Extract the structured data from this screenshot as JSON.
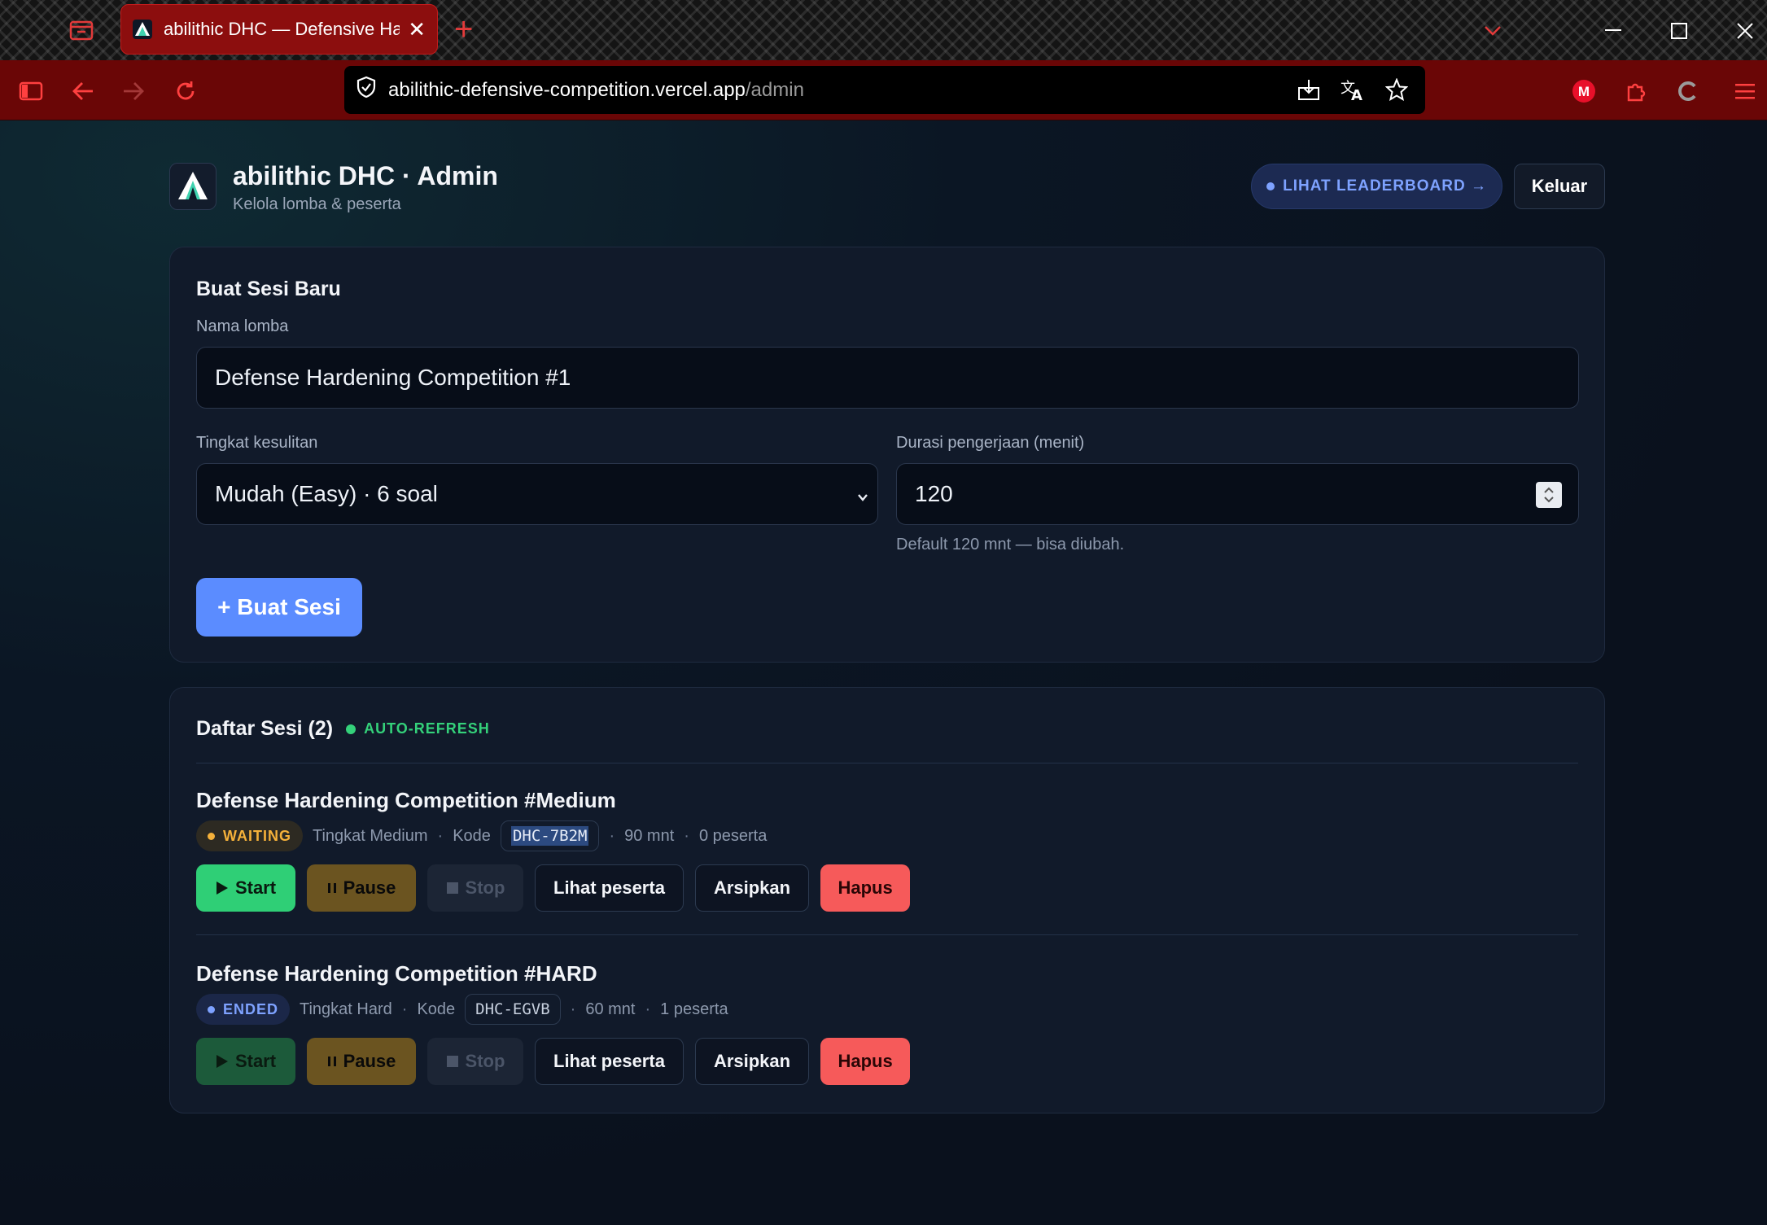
{
  "browser": {
    "tab_title": "abilithic DHC — Defensive Hard",
    "url_host": "abilithic-defensive-competition.vercel.app",
    "url_path": "/admin",
    "profile_initial": "M"
  },
  "header": {
    "title": "abilithic DHC · Admin",
    "subtitle": "Kelola lomba & peserta",
    "leaderboard_label": "LIHAT LEADERBOARD →",
    "logout_label": "Keluar"
  },
  "create_form": {
    "title": "Buat Sesi Baru",
    "name_label": "Nama lomba",
    "name_value": "Defense Hardening Competition #1",
    "difficulty_label": "Tingkat kesulitan",
    "difficulty_value": "Mudah (Easy) · 6 soal",
    "duration_label": "Durasi pengerjaan (menit)",
    "duration_value": "120",
    "duration_hint": "Default 120 mnt — bisa diubah.",
    "submit_label": "+ Buat Sesi"
  },
  "session_list": {
    "title": "Daftar Sesi (2)",
    "auto_refresh_label": "AUTO-REFRESH",
    "code_label": "Kode",
    "sessions": [
      {
        "name": "Defense Hardening Competition #Medium",
        "status": "WAITING",
        "level": "Tingkat Medium",
        "code": "DHC-7B2M",
        "duration": "90 mnt",
        "participants": "0 peserta"
      },
      {
        "name": "Defense Hardening Competition #HARD",
        "status": "ENDED",
        "level": "Tingkat Hard",
        "code": "DHC-EGVB",
        "duration": "60 mnt",
        "participants": "1 peserta"
      }
    ],
    "actions": {
      "start": "Start",
      "pause": "Pause",
      "stop": "Stop",
      "view": "Lihat peserta",
      "archive": "Arsipkan",
      "delete": "Hapus"
    }
  },
  "colors": {
    "accent": "#5b8cff",
    "success": "#2fcf76",
    "warning": "#f5b13a",
    "danger": "#f65a5a",
    "browser_chrome": "#6a0606"
  }
}
